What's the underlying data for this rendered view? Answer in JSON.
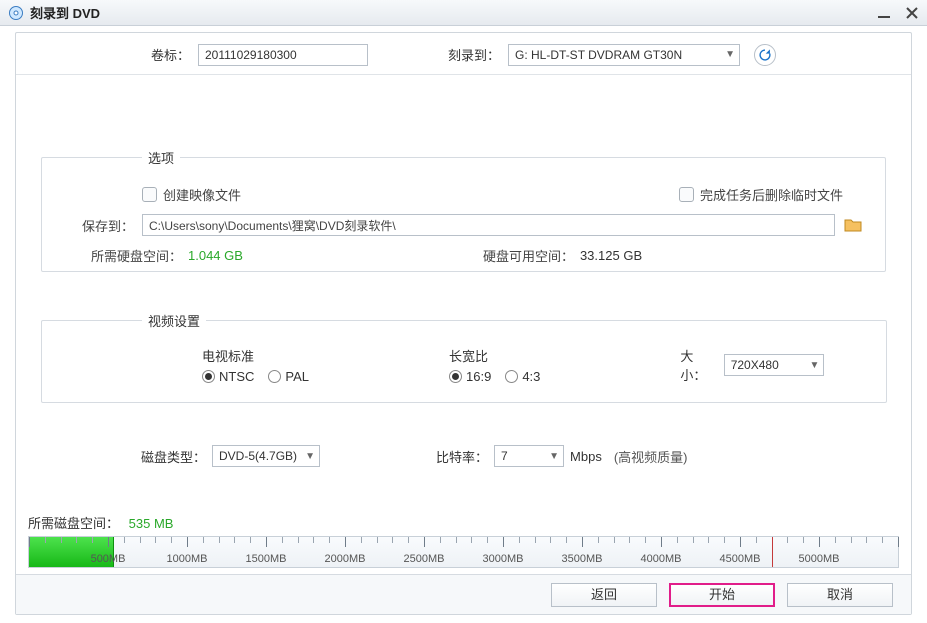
{
  "titlebar": {
    "title": "刻录到 DVD"
  },
  "top": {
    "volume_label_lbl": "卷标：",
    "volume_label_value": "20111029180300",
    "burn_to_lbl": "刻录到：",
    "burn_to_value": "G: HL-DT-ST DVDRAM GT30N"
  },
  "options": {
    "legend": "选项",
    "create_image_label": "创建映像文件",
    "delete_temp_label": "完成任务后删除临时文件",
    "save_to_lbl": "保存到：",
    "save_to_path": "C:\\Users\\sony\\Documents\\狸窝\\DVD刻录软件\\",
    "need_space_lbl": "所需硬盘空间：",
    "need_space_val": "1.044 GB",
    "avail_space_lbl": "硬盘可用空间：",
    "avail_space_val": "33.125 GB"
  },
  "video": {
    "legend": "视频设置",
    "tv_standard_lbl": "电视标准",
    "tv_ntsc": "NTSC",
    "tv_pal": "PAL",
    "aspect_lbl": "长宽比",
    "aspect_169": "16:9",
    "aspect_43": "4:3",
    "size_lbl": "大小：",
    "size_value": "720X480"
  },
  "mid": {
    "disc_type_lbl": "磁盘类型：",
    "disc_type_value": "DVD-5(4.7GB)",
    "bitrate_lbl": "比特率：",
    "bitrate_value": "7",
    "bitrate_unit": "Mbps",
    "bitrate_hint": "(高视频质量)"
  },
  "disk": {
    "need_lbl": "所需磁盘空间：",
    "need_val": "535 MB",
    "tick_labels": [
      "500MB",
      "1000MB",
      "1500MB",
      "2000MB",
      "2500MB",
      "3000MB",
      "3500MB",
      "4000MB",
      "4500MB",
      "5000MB"
    ],
    "axis_max_mb": 5500,
    "fill_mb": 535,
    "limit_mb": 4700
  },
  "buttons": {
    "back": "返回",
    "start": "开始",
    "cancel": "取消"
  }
}
